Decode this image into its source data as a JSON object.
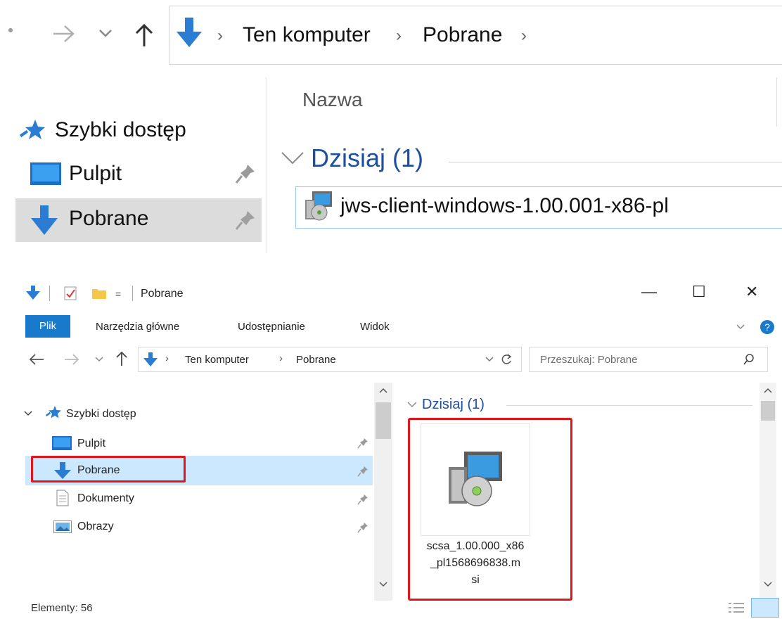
{
  "zoom": {
    "nav": {
      "back_icon": "back-arrow-icon",
      "forward_icon": "forward-arrow-icon",
      "recent_icon": "chevron-down-icon",
      "up_icon": "up-arrow-icon"
    },
    "breadcrumb": [
      "Ten komputer",
      "Pobrane"
    ],
    "column_header": "Nazwa",
    "sidebar": [
      {
        "label": "Szybki dostęp",
        "icon": "star-icon"
      },
      {
        "label": "Pulpit",
        "icon": "desktop-icon",
        "pinned": true
      },
      {
        "label": "Pobrane",
        "icon": "download-arrow-icon",
        "pinned": true,
        "selected": true
      }
    ],
    "group_label": "Dzisiaj (1)",
    "file_name": "jws-client-windows-1.00.001-x86-pl"
  },
  "window": {
    "title": "Pobrane",
    "controls": {
      "minimize": "—",
      "maximize": "☐",
      "close": "✕"
    },
    "ribbon_tabs": [
      "Plik",
      "Narzędzia główne",
      "Udostępnianie",
      "Widok"
    ],
    "breadcrumb": [
      "Ten komputer",
      "Pobrane"
    ],
    "search_placeholder": "Przeszukaj: Pobrane",
    "sidebar": [
      {
        "label": "Szybki dostęp",
        "icon": "star-icon"
      },
      {
        "label": "Pulpit",
        "icon": "desktop-icon"
      },
      {
        "label": "Pobrane",
        "icon": "download-arrow-icon",
        "selected": true
      },
      {
        "label": "Dokumenty",
        "icon": "document-icon"
      },
      {
        "label": "Obrazy",
        "icon": "pictures-icon"
      }
    ],
    "group_label": "Dzisiaj (1)",
    "file_tile": {
      "name_lines": [
        "scsa_1.00.000_x86",
        "_pl1568696838.m",
        "si"
      ],
      "icon": "msi-installer-icon"
    },
    "status": "Elementy: 56",
    "colors": {
      "accent": "#1979ca",
      "highlight": "#e0161b",
      "selection": "#cce8ff",
      "group_text": "#1e4e9e"
    }
  }
}
